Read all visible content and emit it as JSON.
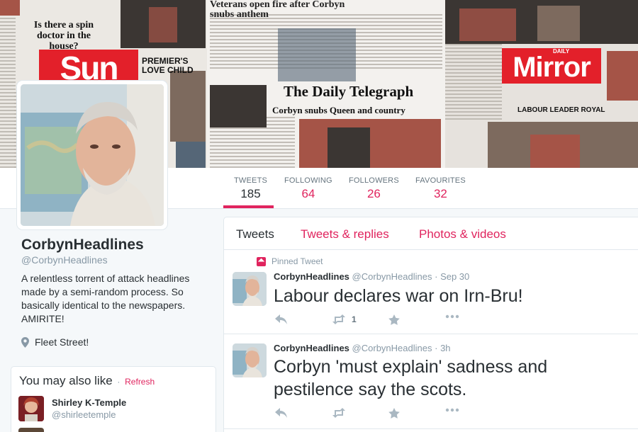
{
  "banner": {
    "sun_headline": "Is there a spin doctor in the house?",
    "sun_logo": "Sun",
    "top_headline": "Veterans open fire after Corbyn snubs anthem",
    "premier_headline": "PREMIER'S LOVE CHILD",
    "telegraph_masthead": "The Daily Telegraph",
    "telegraph_headline": "Corbyn snubs Queen and country",
    "mirror_daily": "DAILY",
    "mirror_logo": "Mirror",
    "mirror_headline": "LABOUR LEADER ROYAL"
  },
  "stats": [
    {
      "label": "TWEETS",
      "value": "185"
    },
    {
      "label": "FOLLOWING",
      "value": "64"
    },
    {
      "label": "FOLLOWERS",
      "value": "26"
    },
    {
      "label": "FAVOURITES",
      "value": "32"
    }
  ],
  "profile": {
    "name": "CorbynHeadlines",
    "handle": "@CorbynHeadlines",
    "bio": "A relentless torrent of attack headlines made by a semi-random process. So basically identical to the newspapers. AMIRITE!",
    "location": "Fleet Street!"
  },
  "suggestions": {
    "title": "You may also like",
    "separator": "·",
    "refresh": "Refresh",
    "items": [
      {
        "name": "Shirley K-Temple",
        "handle": "@shirleetemple"
      }
    ]
  },
  "timeline": {
    "tabs": [
      "Tweets",
      "Tweets & replies",
      "Photos & videos"
    ],
    "tweets": [
      {
        "pinned_label": "Pinned Tweet",
        "name": "CorbynHeadlines",
        "handle": "@CorbynHeadlines",
        "separator": "·",
        "time": "Sep 30",
        "text": "Labour declares war on Irn-Bru!",
        "retweets": "1"
      },
      {
        "name": "CorbynHeadlines",
        "handle": "@CorbynHeadlines",
        "separator": "·",
        "time": "3h",
        "text": "Corbyn 'must explain' sadness and pestilence say the scots.",
        "retweets": ""
      }
    ]
  },
  "colors": {
    "accent": "#e0245e",
    "text": "#292f33",
    "muted": "#8899a6",
    "background": "#f5f8fa"
  }
}
